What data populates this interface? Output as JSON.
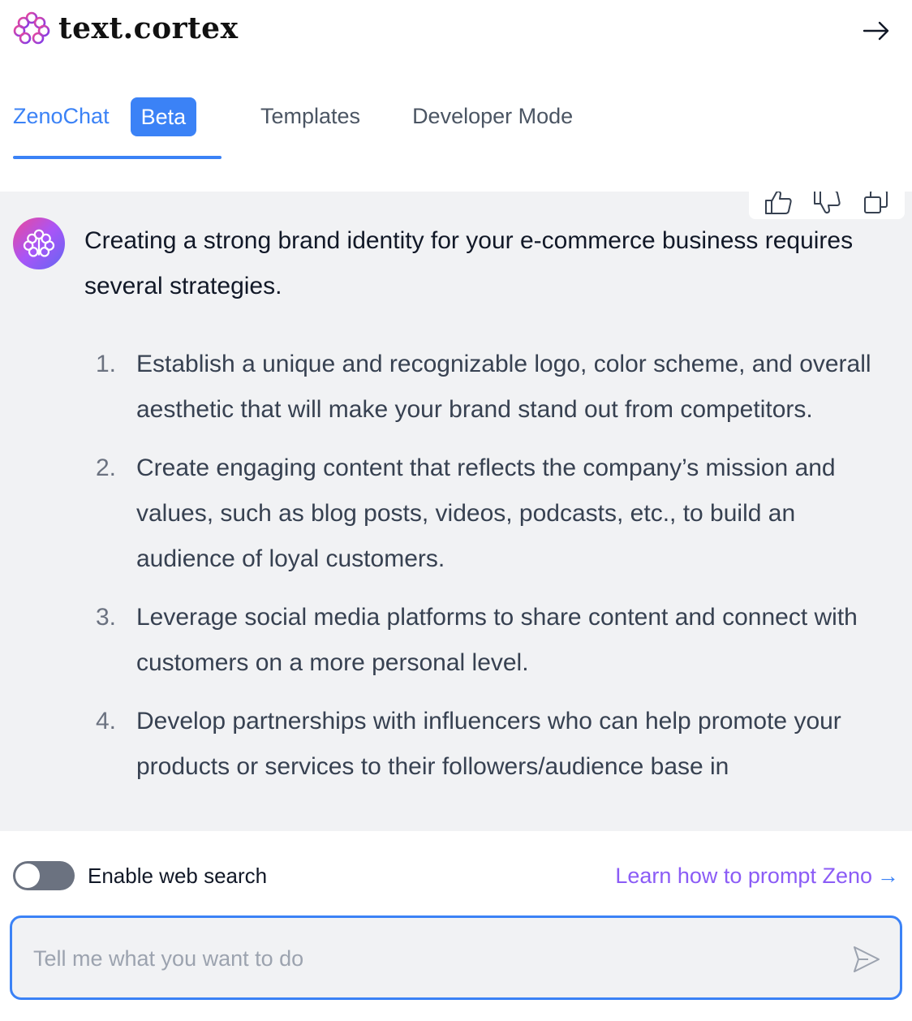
{
  "header": {
    "logo_text": "text.cortex",
    "collapse_icon": "arrow-right-icon"
  },
  "tabs": [
    {
      "label": "ZenoChat",
      "badge": "Beta",
      "active": true
    },
    {
      "label": "Templates",
      "active": false
    },
    {
      "label": "Developer Mode",
      "active": false
    }
  ],
  "message": {
    "actions": [
      "thumbs-up-icon",
      "thumbs-down-icon",
      "copy-icon"
    ],
    "intro": "Creating a strong brand identity for your e-commerce business requires several strategies.",
    "steps": [
      {
        "number": "1.",
        "text": "Establish a unique and recognizable logo, color scheme, and overall aesthetic that will make your brand stand out from competitors."
      },
      {
        "number": "2.",
        "text": "Create engaging content that reflects the company’s mission and values, such as blog posts, videos, podcasts, etc., to build an audience of loyal customers."
      },
      {
        "number": "3.",
        "text": "Leverage social media platforms to share content and connect with customers on a more personal level."
      },
      {
        "number": "4.",
        "text": "Develop partnerships with influencers who can help promote your products or services to their followers/audience base in"
      }
    ]
  },
  "web_search": {
    "label": "Enable web search",
    "enabled": false
  },
  "learn_link": {
    "label": "Learn how to prompt Zeno",
    "arrow": "→"
  },
  "prompt": {
    "placeholder": "Tell me what you want to do",
    "value": ""
  },
  "colors": {
    "accent": "#3b82f6",
    "link_purple": "#8b5cf6",
    "chat_bg": "#f1f2f4"
  }
}
